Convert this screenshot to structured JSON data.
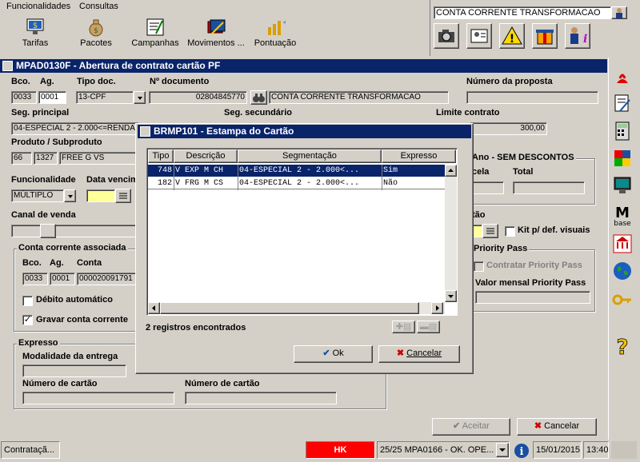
{
  "menu": {
    "items": [
      "Funcionalidades",
      "Consultas"
    ]
  },
  "toolbar": {
    "buttons": [
      {
        "label": "Tarifas",
        "icon": "tarifas-icon"
      },
      {
        "label": "Pacotes",
        "icon": "money-bag-icon"
      },
      {
        "label": "Campanhas",
        "icon": "campaign-icon"
      },
      {
        "label": "Movimentos ...",
        "icon": "movements-icon"
      },
      {
        "label": "Pontuação",
        "icon": "points-icon"
      }
    ]
  },
  "topright": {
    "account_name": "CONTA CORRENTE TRANSFORMACAO"
  },
  "window": {
    "title": "MPAD0130F - Abertura de contrato cartão PF",
    "bco_label": "Bco.",
    "ag_label": "Ag.",
    "tipo_doc_label": "Tipo doc.",
    "num_doc_label": "Nº documento",
    "num_proposta_label": "Número da proposta",
    "bco": "0033",
    "ag": "0001",
    "tipo_doc": "13-CPF",
    "num_doc": "02804845770",
    "nome": "CONTA CORRENTE TRANSFORMACAO",
    "seg_principal_label": "Seg. principal",
    "seg_secundario_label": "Seg. secundário",
    "limite_label": "Limite contrato",
    "seg_principal": "04-ESPECIAL 2 - 2.000<=RENDA",
    "limite": "300,00",
    "produto_label": "Produto / Subproduto",
    "produto": "66",
    "subproduto": "1327",
    "produto_nome": "FREE G VS",
    "ano_label": "Ano - SEM DESCONTOS",
    "parcela_label": "cela",
    "total_label": "Total",
    "funcionalidade_label": "Funcionalidade",
    "data_venc_label": "Data vencim",
    "funcionalidade": "MÚLTIPLO",
    "canal_label": "Canal de venda",
    "cartao_label": "tão",
    "kit_label": "Kit p/ def. visuais",
    "conta_assoc_label": "Conta corrente associada",
    "cc_bco_label": "Bco.",
    "cc_ag_label": "Ag.",
    "cc_conta_label": "Conta",
    "cc_bco": "0033",
    "cc_ag": "0001",
    "cc_conta": "000020091791",
    "debito_label": "Débito automático",
    "gravar_label": "Gravar conta corrente",
    "priority_title": "Priority Pass",
    "priority_contratar": "Contratar Priority Pass",
    "priority_valor_label": "Valor mensal Priority Pass",
    "expresso_title": "Expresso",
    "modalidade_label": "Modalidade da entrega",
    "num_cartao_label": "Número de cartão",
    "num_cartao_label2": "Número de cartão",
    "aceitar_label": "Aceitar",
    "cancelar_label": "Cancelar"
  },
  "dialog": {
    "title": "BRMP101 - Estampa do Cartão",
    "columns": [
      "Tipo",
      "Descrição",
      "Segmentação",
      "Expresso"
    ],
    "rows": [
      {
        "tipo": "748",
        "descricao": "V EXP M CH",
        "segmentacao": "04-ESPECIAL 2 - 2.000<...",
        "expresso": "Sim"
      },
      {
        "tipo": "182",
        "descricao": "V FRG M CS",
        "segmentacao": "04-ESPECIAL 2 - 2.000<...",
        "expresso": "Não"
      }
    ],
    "count_text": "2 registros encontrados",
    "ok_label": "Ok",
    "cancel_label": "Cancelar"
  },
  "statusbar": {
    "left": "Contrataçã...",
    "hk": "HK",
    "message": "25/25 MPA0166 -  OK. OPE...",
    "date": "15/01/2015",
    "time": "13:40"
  },
  "colors": {
    "titlebar": "#0a246a",
    "hk": "#ff0000",
    "selection": "#0a246a"
  }
}
